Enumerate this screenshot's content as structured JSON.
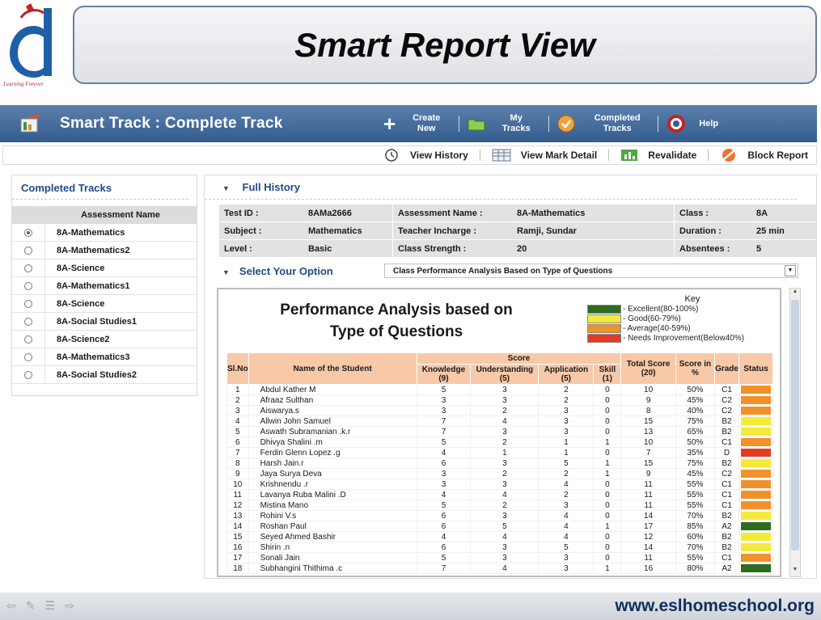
{
  "slide": {
    "title": "Smart Report View",
    "logo_tagline": "Learning Forever",
    "footer_url": "www.eslhomeschool.org"
  },
  "app": {
    "title": "Smart Track : Complete Track",
    "actions": [
      {
        "line1": "Create",
        "line2": "New",
        "icon": "plus-icon"
      },
      {
        "line1": "My",
        "line2": "Tracks",
        "icon": "folder-icon"
      },
      {
        "line1": "Completed",
        "line2": "Tracks",
        "icon": "check-circle-icon"
      },
      {
        "line1": "Help",
        "line2": "",
        "icon": "lifebuoy-icon"
      }
    ]
  },
  "toolbar": {
    "view_history": "View History",
    "view_mark_detail": "View Mark Detail",
    "revalidate": "Revalidate",
    "block_report": "Block Report"
  },
  "left_panel": {
    "title": "Completed Tracks",
    "column_header": "Assessment Name",
    "items": [
      {
        "name": "8A-Mathematics",
        "selected": true
      },
      {
        "name": "8A-Mathematics2",
        "selected": false
      },
      {
        "name": "8A-Science",
        "selected": false
      },
      {
        "name": "8A-Mathematics1",
        "selected": false
      },
      {
        "name": "8A-Science",
        "selected": false
      },
      {
        "name": "8A-Social Studies1",
        "selected": false
      },
      {
        "name": "8A-Science2",
        "selected": false
      },
      {
        "name": "8A-Mathematics3",
        "selected": false
      },
      {
        "name": "8A-Social Studies2",
        "selected": false
      }
    ]
  },
  "history": {
    "title": "Full History",
    "test_id_label": "Test ID :",
    "test_id": "8AMa2666",
    "assessment_label": "Assessment Name :",
    "assessment": "8A-Mathematics",
    "class_label": "Class :",
    "class": "8A",
    "subject_label": "Subject :",
    "subject": "Mathematics",
    "teacher_label": "Teacher Incharge :",
    "teacher": "Ramji, Sundar",
    "duration_label": "Duration :",
    "duration": "25 min",
    "level_label": "Level :",
    "level": "Basic",
    "strength_label": "Class Strength :",
    "strength": "20",
    "absentees_label": "Absentees :",
    "absentees": "5"
  },
  "option": {
    "label": "Select Your Option",
    "selected": "Class Performance Analysis Based on Type of Questions"
  },
  "report": {
    "title_line1": "Performance Analysis based on",
    "title_line2": "Type of Questions",
    "key_title": "Key",
    "key": [
      {
        "label": "- Excellent(80-100%)",
        "color": "#2e6b20"
      },
      {
        "label": "- Good(60-79%)",
        "color": "#f4ea3a"
      },
      {
        "label": "- Average(40-59%)",
        "color": "#f0922b"
      },
      {
        "label": "- Needs Improvement(Below40%)",
        "color": "#e23b25"
      }
    ],
    "headers": {
      "slno": "Sl.No",
      "name": "Name of the Student",
      "score_group": "Score",
      "knowledge": "Knowledge (9)",
      "understanding": "Understanding (5)",
      "application": "Application (5)",
      "skill": "Skill (1)",
      "total": "Total Score (20)",
      "percent": "Score in %",
      "grade": "Grade",
      "status": "Status"
    },
    "rows": [
      {
        "sl": "1",
        "name": "Abdul Kather M",
        "k": "5",
        "u": "3",
        "a": "2",
        "s": "0",
        "t": "10",
        "p": "50%",
        "g": "C1",
        "status": "#f0922b"
      },
      {
        "sl": "2",
        "name": "Afraaz Sulthan",
        "k": "3",
        "u": "3",
        "a": "2",
        "s": "0",
        "t": "9",
        "p": "45%",
        "g": "C2",
        "status": "#f0922b"
      },
      {
        "sl": "3",
        "name": "Aiswarya.s",
        "k": "3",
        "u": "2",
        "a": "3",
        "s": "0",
        "t": "8",
        "p": "40%",
        "g": "C2",
        "status": "#f0922b"
      },
      {
        "sl": "4",
        "name": "Allwin John Samuel",
        "k": "7",
        "u": "4",
        "a": "3",
        "s": "0",
        "t": "15",
        "p": "75%",
        "g": "B2",
        "status": "#f4ea3a"
      },
      {
        "sl": "5",
        "name": "Aswath Subramanian .k.r",
        "k": "7",
        "u": "3",
        "a": "3",
        "s": "0",
        "t": "13",
        "p": "65%",
        "g": "B2",
        "status": "#f4ea3a"
      },
      {
        "sl": "6",
        "name": "Dhivya Shalini .m",
        "k": "5",
        "u": "2",
        "a": "1",
        "s": "1",
        "t": "10",
        "p": "50%",
        "g": "C1",
        "status": "#f0922b"
      },
      {
        "sl": "7",
        "name": "Ferdin Glenn Lopez .g",
        "k": "4",
        "u": "1",
        "a": "1",
        "s": "0",
        "t": "7",
        "p": "35%",
        "g": "D",
        "status": "#e23b25"
      },
      {
        "sl": "8",
        "name": "Harsh Jain.r",
        "k": "6",
        "u": "3",
        "a": "5",
        "s": "1",
        "t": "15",
        "p": "75%",
        "g": "B2",
        "status": "#f4ea3a"
      },
      {
        "sl": "9",
        "name": "Jaya Surya Deva",
        "k": "3",
        "u": "2",
        "a": "2",
        "s": "1",
        "t": "9",
        "p": "45%",
        "g": "C2",
        "status": "#f0922b"
      },
      {
        "sl": "10",
        "name": "Krishnendu .r",
        "k": "3",
        "u": "3",
        "a": "4",
        "s": "0",
        "t": "11",
        "p": "55%",
        "g": "C1",
        "status": "#f0922b"
      },
      {
        "sl": "11",
        "name": "Lavanya Ruba Malini .D",
        "k": "4",
        "u": "4",
        "a": "2",
        "s": "0",
        "t": "11",
        "p": "55%",
        "g": "C1",
        "status": "#f0922b"
      },
      {
        "sl": "12",
        "name": "Mistina Mano",
        "k": "5",
        "u": "2",
        "a": "3",
        "s": "0",
        "t": "11",
        "p": "55%",
        "g": "C1",
        "status": "#f0922b"
      },
      {
        "sl": "13",
        "name": "Rohini V.s",
        "k": "6",
        "u": "3",
        "a": "4",
        "s": "0",
        "t": "14",
        "p": "70%",
        "g": "B2",
        "status": "#f4ea3a"
      },
      {
        "sl": "14",
        "name": "Roshan Paul",
        "k": "6",
        "u": "5",
        "a": "4",
        "s": "1",
        "t": "17",
        "p": "85%",
        "g": "A2",
        "status": "#2e6b20"
      },
      {
        "sl": "15",
        "name": "Seyed Ahmed Bashir",
        "k": "4",
        "u": "4",
        "a": "4",
        "s": "0",
        "t": "12",
        "p": "60%",
        "g": "B2",
        "status": "#f4ea3a"
      },
      {
        "sl": "16",
        "name": "Shirin .n",
        "k": "6",
        "u": "3",
        "a": "5",
        "s": "0",
        "t": "14",
        "p": "70%",
        "g": "B2",
        "status": "#f4ea3a"
      },
      {
        "sl": "17",
        "name": "Sonali Jain",
        "k": "5",
        "u": "3",
        "a": "3",
        "s": "0",
        "t": "11",
        "p": "55%",
        "g": "C1",
        "status": "#f0922b"
      },
      {
        "sl": "18",
        "name": "Subhangini Thithima .c",
        "k": "7",
        "u": "4",
        "a": "3",
        "s": "1",
        "t": "16",
        "p": "80%",
        "g": "A2",
        "status": "#2e6b20"
      }
    ]
  }
}
